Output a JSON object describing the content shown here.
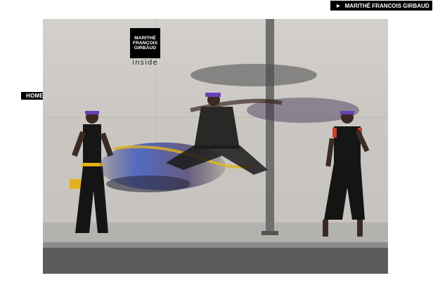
{
  "header": {
    "brand_link_label": "MARITHÉ FRANCOIS GIRBAUD",
    "arrow_icon": "play-arrow-icon"
  },
  "nav": {
    "home_label": "HOME"
  },
  "hero": {
    "logo_lines": [
      "MARITHÉ",
      "FRANÇOIS",
      "GIRBAUD"
    ],
    "logo_subtitle": "inside",
    "image_description_icon": "dancers-street-photo"
  },
  "colors": {
    "black": "#000000",
    "wall": "#c9c6c2",
    "sidewalk": "#b4b2ae",
    "road": "#5a5b5c",
    "accent_purple": "#6a3fb8",
    "accent_blue": "#2d4fc4",
    "accent_yellow": "#e3b21d"
  }
}
